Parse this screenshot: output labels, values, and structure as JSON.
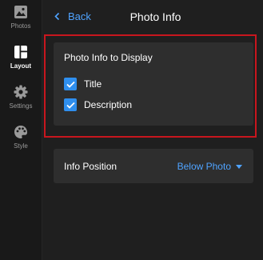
{
  "sidebar": {
    "items": [
      {
        "label": "Photos",
        "icon": "image-icon",
        "active": false
      },
      {
        "label": "Layout",
        "icon": "layout-icon",
        "active": true
      },
      {
        "label": "Settings",
        "icon": "gear-icon",
        "active": false
      },
      {
        "label": "Style",
        "icon": "palette-icon",
        "active": false
      }
    ]
  },
  "header": {
    "back_label": "Back",
    "title": "Photo Info"
  },
  "photo_info": {
    "title": "Photo Info to Display",
    "options": [
      {
        "label": "Title",
        "checked": true
      },
      {
        "label": "Description",
        "checked": true
      }
    ]
  },
  "info_position": {
    "label": "Info Position",
    "value": "Below Photo"
  },
  "colors": {
    "accent": "#4fa3ff",
    "checkbox": "#2f8fef",
    "highlight": "#c8161e",
    "card": "#2e2e2e",
    "background": "#1f1f1f"
  }
}
